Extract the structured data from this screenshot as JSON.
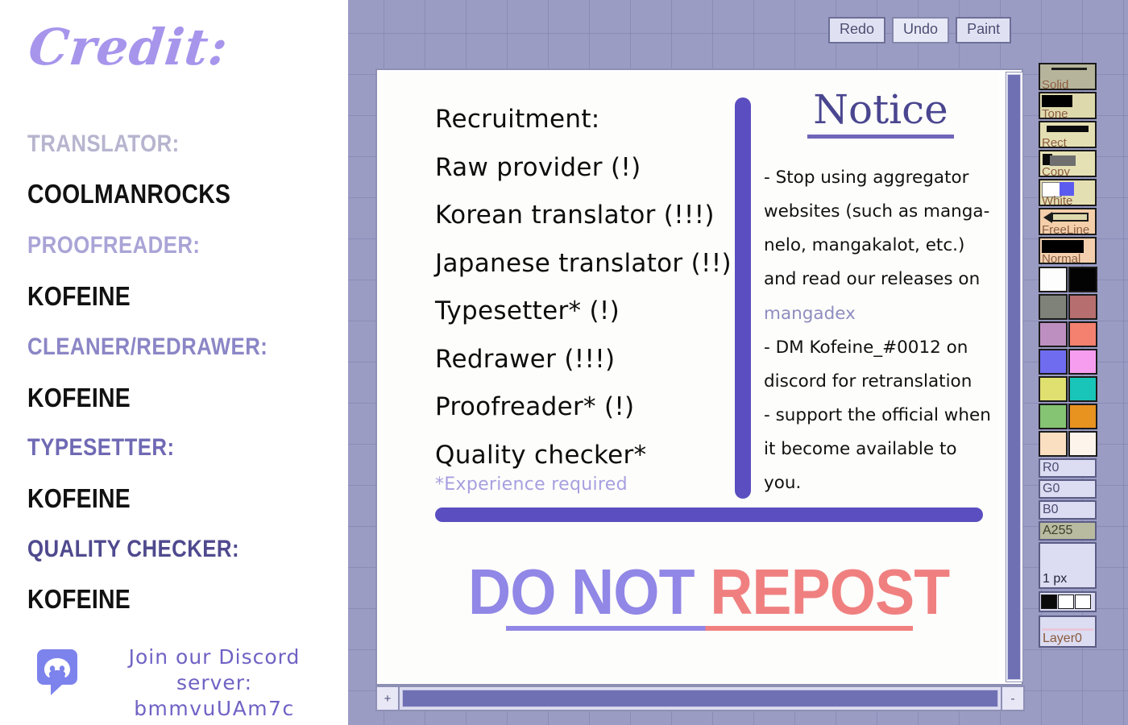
{
  "credit": {
    "title": "Credit:",
    "roles": [
      {
        "label": "TRANSLATOR:",
        "name": "COOLMANROCKS",
        "color": "#b7b4cf"
      },
      {
        "label": "PROOFREADER:",
        "name": "KOFEINE",
        "color": "#a9a4d6"
      },
      {
        "label": "CLEANER/REDRAWER:",
        "name": "KOFEINE",
        "color": "#8b86c6"
      },
      {
        "label": "TYPESETTER:",
        "name": "KOFEINE",
        "color": "#6f69b4"
      },
      {
        "label": "QUALITY CHECKER:",
        "name": "KOFEINE",
        "color": "#4f4a8e"
      }
    ],
    "discord": {
      "icon": "discord-icon",
      "line1": "Join our Discord server:",
      "line2": "bmmvuUAm7c"
    }
  },
  "toolbar": {
    "buttons": [
      {
        "label": "Redo"
      },
      {
        "label": "Undo"
      },
      {
        "label": "Paint"
      }
    ]
  },
  "canvas": {
    "recruitment": {
      "heading": "Recruitment:",
      "items": [
        "Raw provider (!)",
        "Korean translator (!!!)",
        "Japanese translator (!!)",
        "Typesetter* (!)",
        "Redrawer (!!!)",
        "Proofreader* (!)",
        "Quality checker*"
      ],
      "footnote": "*Experience required"
    },
    "notice": {
      "title": "Notice",
      "lines": [
        "- Stop using aggregator",
        "websites (such as manga-",
        "nelo, mangakalot, etc.)",
        "and read our releases on"
      ],
      "link": "mangadex",
      "lines2": [
        "- DM Kofeine_#0012 on",
        "discord for retranslation",
        "- support the official when",
        "it become available to you."
      ]
    },
    "watermark": {
      "part1": "DO NOT ",
      "part2": "REPOST",
      "color1": "#9187e6",
      "color2": "#f08080"
    }
  },
  "palette": {
    "tools": [
      {
        "label": "Solid"
      },
      {
        "label": "Tone"
      },
      {
        "label": "Rect"
      },
      {
        "label": "Copy"
      },
      {
        "label": "White"
      },
      {
        "label": "FreeLine"
      },
      {
        "label": "Normal"
      }
    ],
    "colors": [
      "#fdfdfd",
      "#030303",
      "#7e8279",
      "#b76e6e",
      "#bd8fc1",
      "#f4806f",
      "#6f6cf0",
      "#f79df0",
      "#e0e070",
      "#19c4b8",
      "#85c473",
      "#e89220",
      "#fadfc0",
      "#fdf4ec"
    ],
    "channels": [
      {
        "label": "R0",
        "selected": false
      },
      {
        "label": "G0",
        "selected": false
      },
      {
        "label": "B0",
        "selected": false
      },
      {
        "label": "A255",
        "selected": true
      }
    ],
    "brush_size": "1 px",
    "mini_swatches": [
      "#0a0a0a",
      "#ffffff",
      "#ffffff"
    ],
    "layer": "Layer0"
  },
  "scrollbars": {
    "h_left_button": "+",
    "h_right_button": "-"
  }
}
